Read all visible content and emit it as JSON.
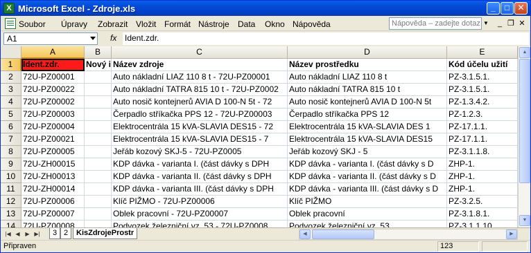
{
  "window": {
    "title": "Microsoft Excel - Zdroje.xls",
    "app_icon_letter": "X",
    "minimize": "_",
    "maximize": "□",
    "close": "✕"
  },
  "menu": {
    "items": [
      "Soubor",
      "Úpravy",
      "Zobrazit",
      "Vložit",
      "Formát",
      "Nástroje",
      "Data",
      "Okno",
      "Nápověda"
    ],
    "help_placeholder": "Nápověda – zadejte dotaz"
  },
  "formula_bar": {
    "name_box": "A1",
    "fx": "fx",
    "content": "Ident.zdr."
  },
  "columns": [
    "A",
    "B",
    "C",
    "D",
    "E"
  ],
  "rows": [
    {
      "num": "1",
      "cells": [
        "Ident.zdr.",
        "Nový i",
        "Název zdroje",
        "Název prostředku",
        "Kód účelu užití"
      ]
    },
    {
      "num": "2",
      "cells": [
        "72U-PZ00001",
        "",
        "Auto nákladní LIAZ 110 8 t - 72U-PZ00001",
        "Auto nákladní LIAZ 110  8 t",
        "PZ-3.1.5.1."
      ]
    },
    {
      "num": "3",
      "cells": [
        "72U-PZ00022",
        "",
        "Auto nákladní TATRA 815 10 t - 72U-PZ0002",
        "Auto nákladní TATRA 815 10 t",
        "PZ-3.1.5.1."
      ]
    },
    {
      "num": "4",
      "cells": [
        "72U-PZ00002",
        "",
        "Auto nosič kontejnerů AVIA D 100-N 5t - 72",
        "Auto nosič kontejnerů AVIA D 100-N 5t",
        "PZ-1.3.4.2."
      ]
    },
    {
      "num": "5",
      "cells": [
        "72U-PZ00003",
        "",
        "Čerpadlo stříkačka PPS 12 - 72U-PZ00003",
        "Čerpadlo stříkačka PPS 12",
        "PZ-1.2.3."
      ]
    },
    {
      "num": "6",
      "cells": [
        "72U-PZ00004",
        "",
        "Elektrocentrála 15 kVA-SLAVIA DES15 - 72",
        "Elektrocentrála 15 kVA-SLAVIA DES 1",
        "PZ-17.1.1."
      ]
    },
    {
      "num": "7",
      "cells": [
        "72U-PZ00021",
        "",
        "Elektrocentrála 15 kVA-SLAVIA DES15 - 7",
        "Elektrocentrála 15 kVA-SLAVIA DES15",
        "PZ-17.1.1."
      ]
    },
    {
      "num": "8",
      "cells": [
        "72U-PZ00005",
        "",
        "Jeřáb kozový SKJ-5 - 72U-PZ0005",
        "Jeřáb kozový  SKJ - 5",
        "PZ-3.1.1.8."
      ]
    },
    {
      "num": "9",
      "cells": [
        "72U-ZH00015",
        "",
        "KDP dávka - varianta I. (část dávky s DPH",
        "KDP dávka - varianta I. (část dávky s D",
        "ZHP-1."
      ]
    },
    {
      "num": "10",
      "cells": [
        "72U-ZH00013",
        "",
        "KDP dávka - varianta II. (část dávky s DPH",
        "KDP dávka - varianta II. (část dávky s D",
        "ZHP-1."
      ]
    },
    {
      "num": "11",
      "cells": [
        "72U-ZH00014",
        "",
        "KDP dávka - varianta III. (část dávky s DPH",
        "KDP dávka - varianta III. (část dávky s D",
        "ZHP-1."
      ]
    },
    {
      "num": "12",
      "cells": [
        "72U-PZ00006",
        "",
        "Klíč PIŽMO - 72U-PZ00006",
        "Klíč PIŽMO",
        "PZ-3.2.5."
      ]
    },
    {
      "num": "13",
      "cells": [
        "72U-PZ00007",
        "",
        "Oblek pracovní - 72U-PZ00007",
        "Oblek pracovní",
        "PZ-3.1.8.1."
      ]
    },
    {
      "num": "14",
      "cells": [
        "72U-PZ00008",
        "",
        "Podvozek železniční vz. 53 - 72U-PZ0008",
        "Podvozek železniční vz. 53",
        "PZ-3.1.1.10."
      ]
    }
  ],
  "tabs": {
    "sheets": [
      "3",
      "2",
      "KisZdrojeProstr"
    ],
    "active": "KisZdrojeProstr"
  },
  "status": {
    "text": "Připraven",
    "num": "123"
  }
}
